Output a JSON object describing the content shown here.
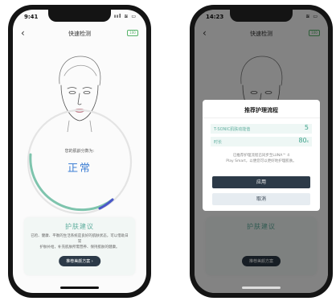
{
  "left_phone": {
    "status": {
      "time": "9:41",
      "icons": "ııl ≋ ▭"
    },
    "nav": {
      "back": "‹",
      "title": "快速检测",
      "battery": "100"
    },
    "score": {
      "label": "您的肌龄分数为:",
      "value": "正常",
      "level": 0.55,
      "colors": {
        "track": "#e4e4e4",
        "arc_start": "#7ec4ad",
        "arc_end": "#4a57c8"
      }
    },
    "care": {
      "title": "护肤建议",
      "desc_line1": "已检、健康、平衡的生活系统是良好的肌肤状态，可以借助日常",
      "desc_line2": "护肤补给，补充肌肤所需营养、保持肌肤的健康。",
      "button": "推荐美颜方案 ›"
    }
  },
  "right_phone": {
    "status": {
      "time": "14:23",
      "icons": "≋ ▭"
    },
    "nav": {
      "back": "‹",
      "title": "快速检测",
      "battery": "100"
    },
    "background_card": {
      "title": "护肤建议",
      "button": "推荐美颜方案"
    },
    "dialog": {
      "title": "推荐护理流程",
      "rows": [
        {
          "label": "T-SONIC肌肤动能值",
          "value": "5",
          "unit": ""
        },
        {
          "label": "时长",
          "value": "80",
          "unit": "s"
        }
      ],
      "note_line1": "已推荐护理流程已同步至LUNA™ 4",
      "note_line2": "Play Smart，以便您可以更好地护理肌肤。",
      "apply": "应用",
      "cancel": "取消"
    }
  },
  "colors": {
    "accent_green": "#5fae9e",
    "dark_button": "#2c3a48",
    "score_blue": "#3d7fd4"
  }
}
